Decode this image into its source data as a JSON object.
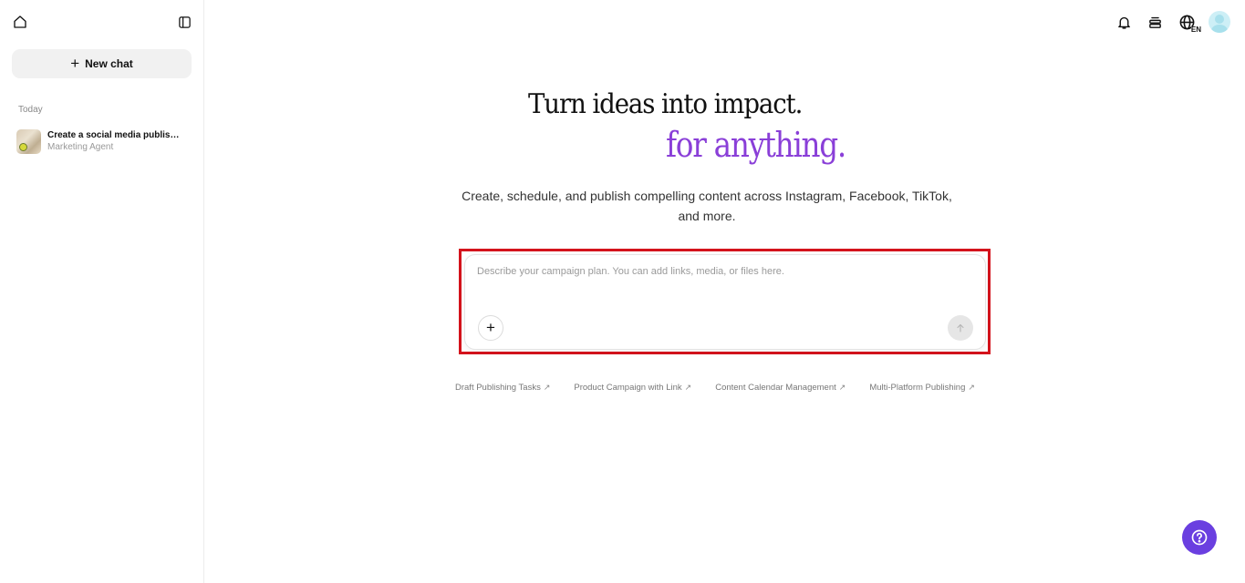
{
  "sidebar": {
    "new_chat_label": "New chat",
    "section_label": "Today",
    "chats": [
      {
        "title": "Create a social media publishin...",
        "subtitle": "Marketing Agent"
      }
    ]
  },
  "topbar": {
    "language": "EN"
  },
  "hero": {
    "headline": "Turn ideas into impact.",
    "headline_accent": "for anything.",
    "subtitle": "Create, schedule, and publish compelling content across Instagram, Facebook, TikTok, and more."
  },
  "prompt": {
    "placeholder": "Describe your campaign plan. You can add links, media, or files here.",
    "value": ""
  },
  "suggestions": [
    {
      "label": "Draft Publishing Tasks",
      "arrow": "↗"
    },
    {
      "label": "Product Campaign with Link",
      "arrow": "↗"
    },
    {
      "label": "Content Calendar Management",
      "arrow": "↗"
    },
    {
      "label": "Multi-Platform Publishing",
      "arrow": "↗"
    }
  ],
  "icons": {
    "home": "home-icon",
    "collapse": "sidebar-collapse-icon",
    "bell": "bell-icon",
    "stack": "stack-icon",
    "globe": "globe-icon",
    "help": "help-icon",
    "send": "arrow-up-icon",
    "attach": "plus-icon"
  },
  "colors": {
    "accent_purple": "#8a3fd8",
    "help_button": "#6a3fe0",
    "highlight_outline": "#d4131c"
  }
}
